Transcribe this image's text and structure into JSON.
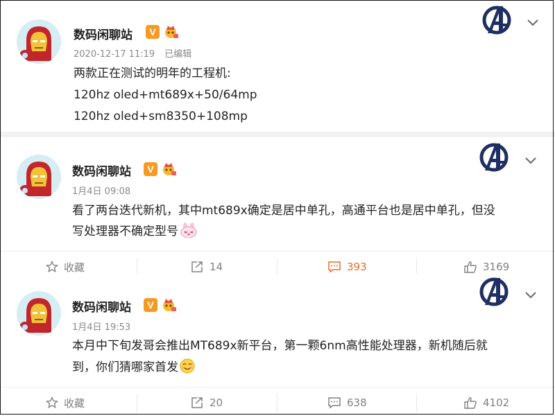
{
  "posts": [
    {
      "author": "数码闲聊站",
      "verified_badge": "V",
      "meta_time": "2020-12-17 11:19",
      "meta_edited": "已编辑",
      "lines": [
        "两款正在测试的明年的工程机:",
        "120hz oled+mt689x+50/64mp",
        "120hz oled+sm8350+108mp"
      ]
    },
    {
      "author": "数码闲聊站",
      "verified_badge": "V",
      "meta_time": "1月4日 09:08",
      "text_line1": "看了两台迭代新机，其中mt689x确定是居中单孔，高通平台也是居中单孔，但没",
      "text_line2": "写处理器不确定型号",
      "emoji": "bunny-emoji",
      "actions": {
        "favorite": "收藏",
        "repost": "14",
        "comment": "393",
        "like": "3169"
      }
    },
    {
      "author": "数码闲聊站",
      "verified_badge": "V",
      "meta_time": "1月4日 19:53",
      "text_line1": "本月中下旬发哥会推出MT689x新平台，第一颗6nm高性能处理器，新机随后就",
      "text_line2": "到，你们猜哪家首发",
      "emoji": "smile-emoji",
      "actions": {
        "favorite": "收藏",
        "repost": "20",
        "comment": "638",
        "like": "4102"
      }
    }
  ],
  "colors": {
    "accent_orange": "#e86b24",
    "badge_orange": "#f59a23",
    "muted": "#8a8a8a"
  }
}
